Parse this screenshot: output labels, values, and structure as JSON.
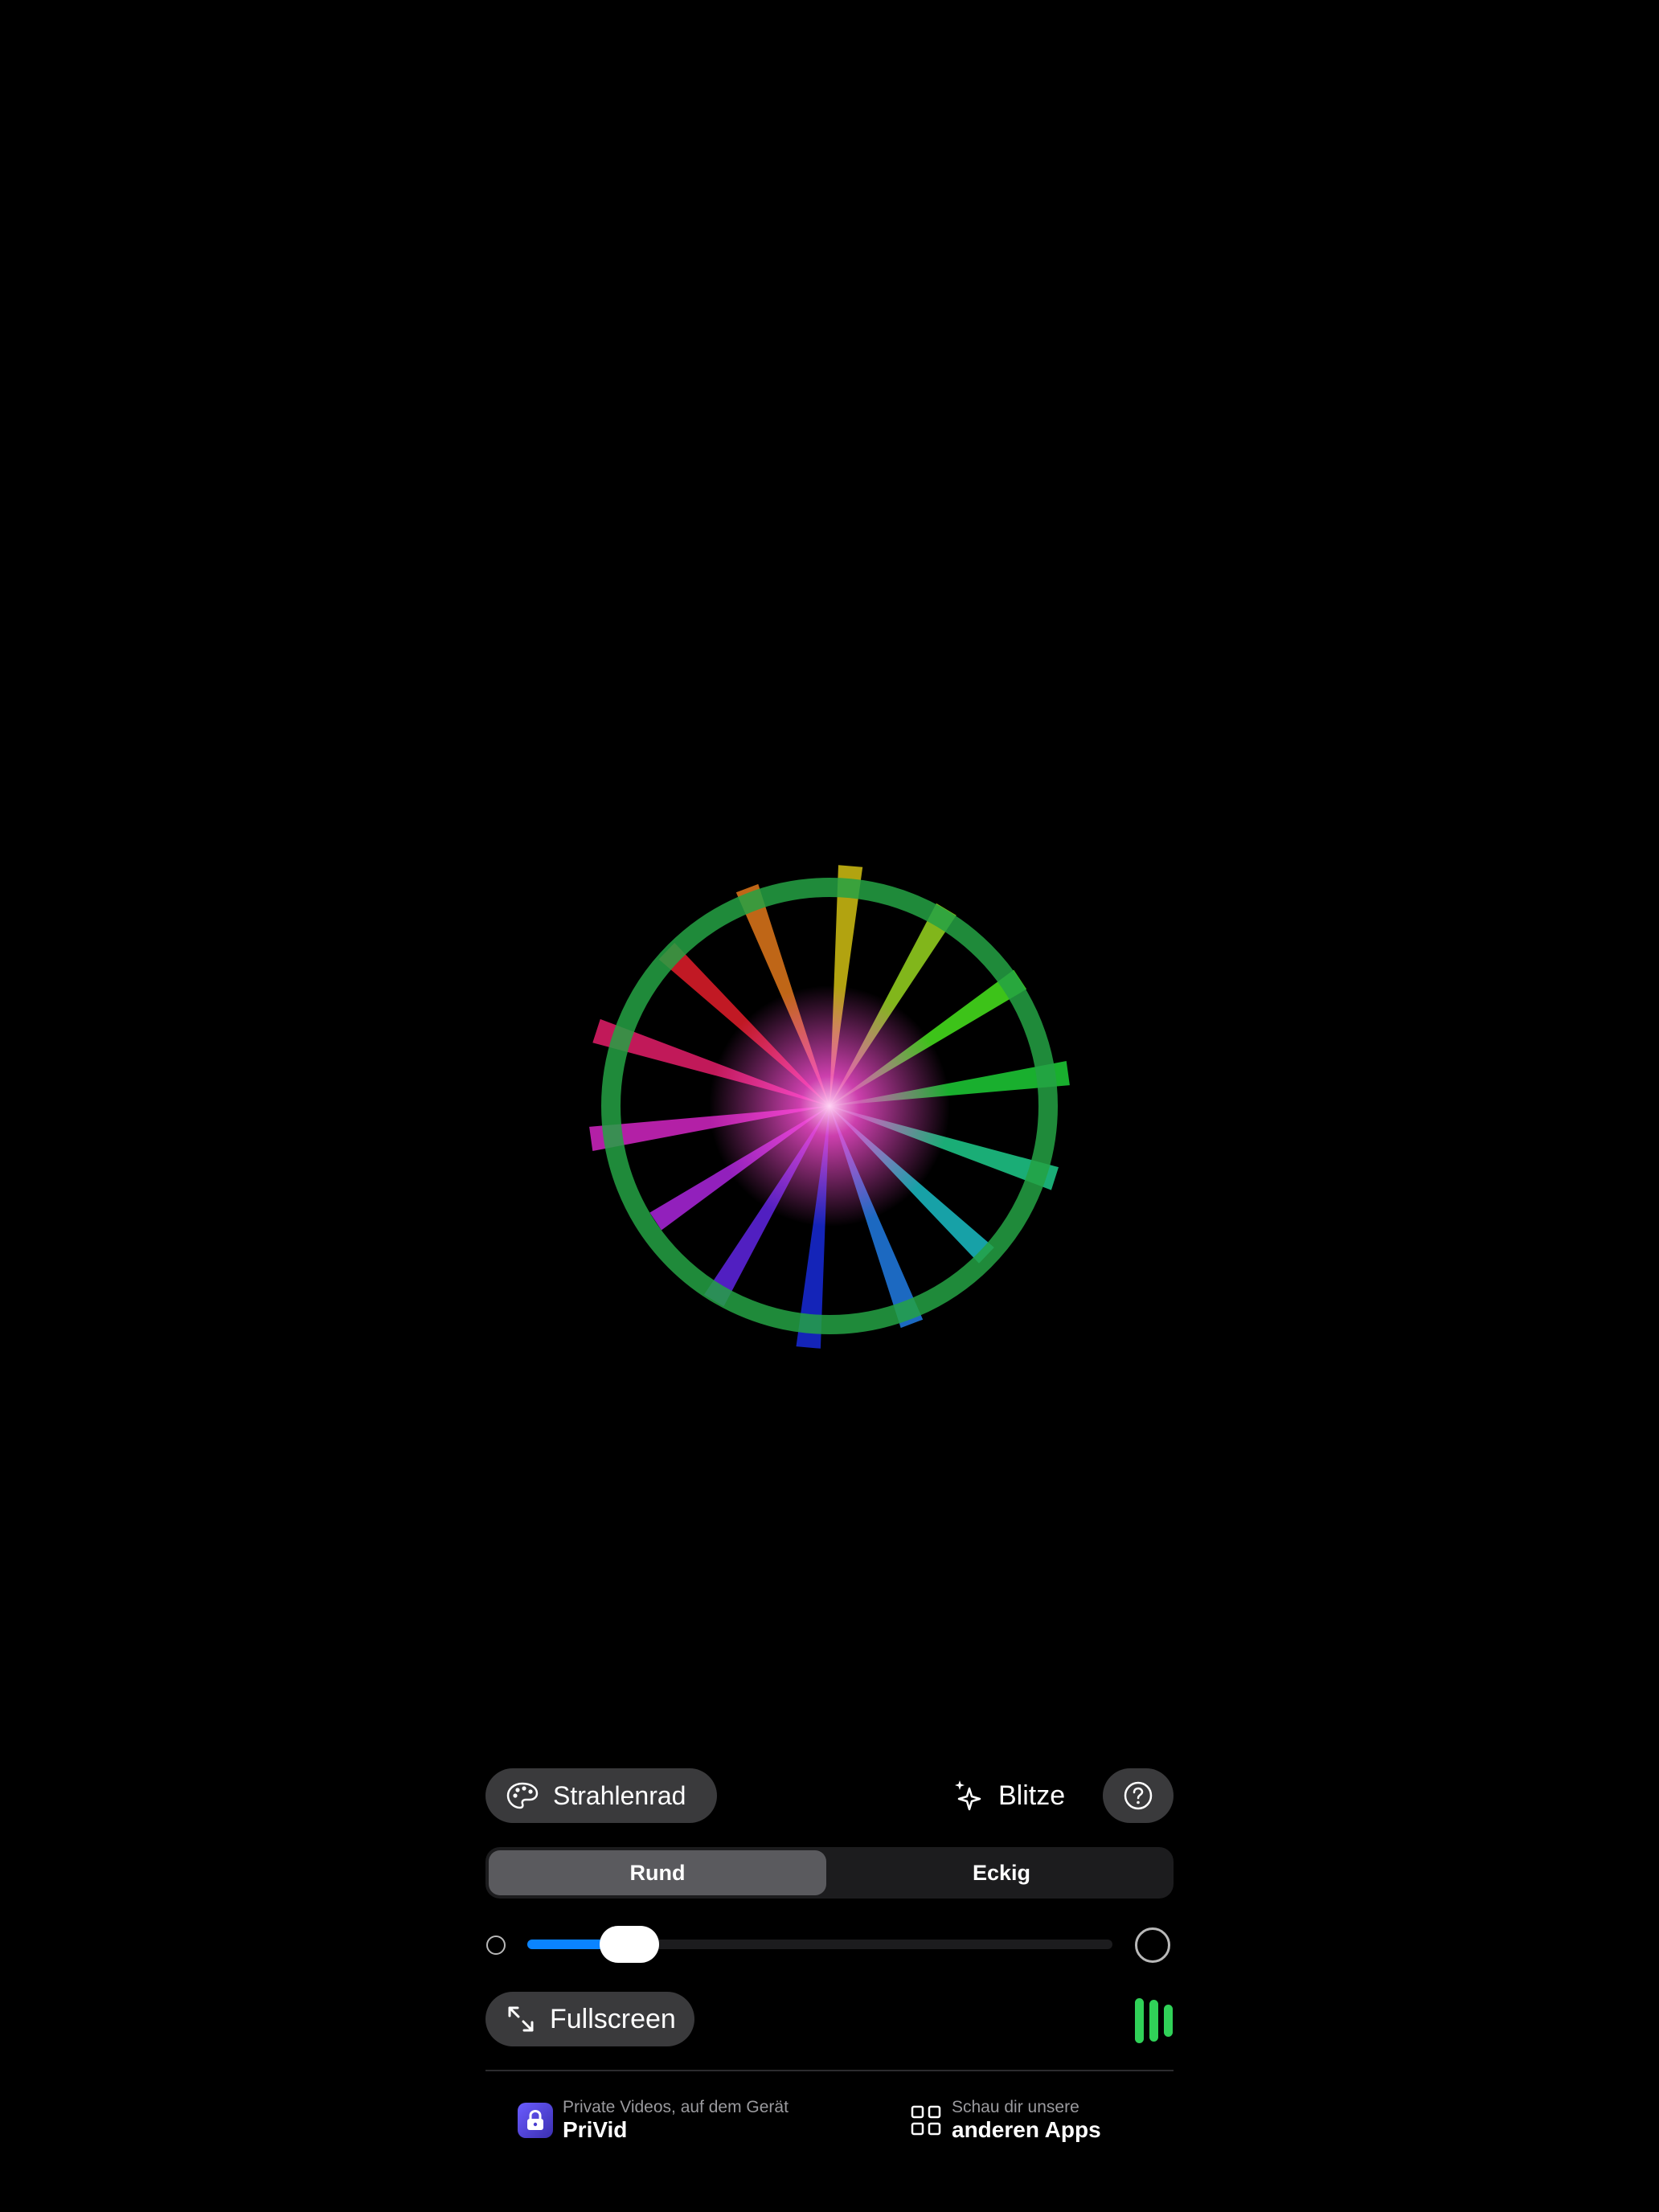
{
  "visualizer": {
    "ring_color": "#25a244",
    "center_glow_color": "#ff4fd8",
    "ray_colors": [
      "#c5b512",
      "#8fca1e",
      "#44d81c",
      "#1cc233",
      "#1dc083",
      "#19b3b9",
      "#1f74d6",
      "#1628cc",
      "#5a22d6",
      "#a223d0",
      "#c723b8",
      "#d61c63",
      "#d61c28",
      "#d4711a"
    ]
  },
  "controls": {
    "theme_label": "Strahlenrad",
    "flashes_label": "Blitze",
    "shape_segments": [
      "Rund",
      "Eckig"
    ],
    "selected_shape": "Rund",
    "size_slider_value": 0.175,
    "fullscreen_label": "Fullscreen",
    "accent_color": "#0a84ff",
    "levels_color": "#30d158"
  },
  "footer": {
    "privid_subtitle": "Private Videos, auf dem Gerät",
    "privid_title": "PriVid",
    "other_apps_subtitle": "Schau dir unsere",
    "other_apps_title": "anderen Apps"
  }
}
